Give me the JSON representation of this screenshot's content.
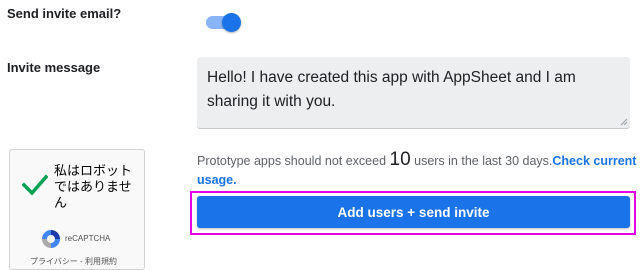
{
  "settings": {
    "send_invite_label": "Send invite email?",
    "send_invite_enabled": true,
    "invite_message_label": "Invite message",
    "invite_message": "Hello! I have created this app with AppSheet and I am sharing it with you."
  },
  "captcha": {
    "text": "私はロボットではありません",
    "brand": "reCAPTCHA",
    "links": "プライバシー - 利用規約"
  },
  "quota": {
    "prefix": "Prototype apps should not exceed ",
    "limit": "10",
    "suffix": " users in the last 30 days.",
    "link_text": "Check current usage."
  },
  "actions": {
    "submit_label": "Add users + send invite"
  },
  "colors": {
    "accent": "#1a73e8",
    "focus_ring": "#e600e6",
    "check": "#00a152"
  }
}
